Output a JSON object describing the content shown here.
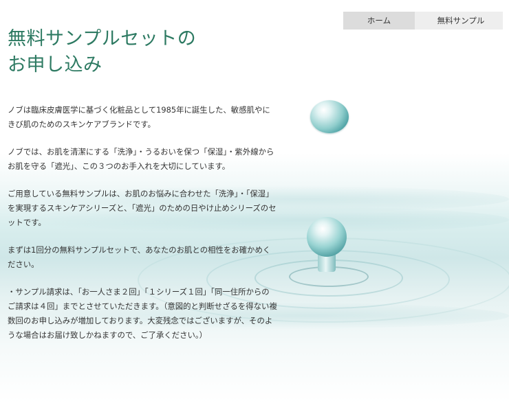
{
  "breadcrumb": {
    "home": "ホーム",
    "current": "無料サンプル"
  },
  "title": {
    "line1": "無料サンプルセットの",
    "line2": "お申し込み"
  },
  "paragraphs": [
    "ノブは臨床皮膚医学に基づく化粧品として1985年に誕生した、敏感肌やにきび肌のためのスキンケアブランドです。",
    "ノブでは、お肌を清潔にする「洗浄」・うるおいを保つ「保湿」・紫外線からお肌を守る「遮光」、この３つのお手入れを大切にしています。",
    "ご用意している無料サンプルは、お肌のお悩みに合わせた「洗浄」・「保湿」を実現するスキンケアシリーズと、「遮光」のための日やけ止めシリーズのセットです。",
    "まずは1回分の無料サンプルセットで、あなたのお肌との相性をお確かめください。",
    "・サンプル請求は、「お一人さま２回」「１シリーズ１回」「同一住所からのご請求は４回」までとさせていただきます。（意図的と判断せざるを得ない複数回のお申し込みが増加しております。大変残念ではございますが、そのような場合はお届け致しかねますので、ご了承ください。）"
  ]
}
